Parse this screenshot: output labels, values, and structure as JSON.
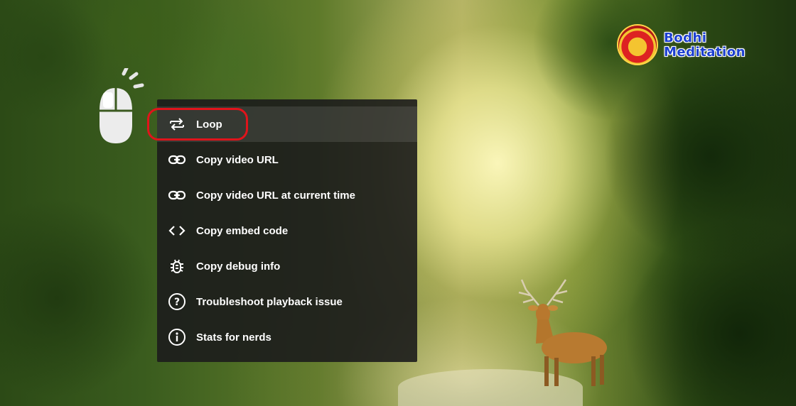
{
  "logo": {
    "line1": "Bodhi",
    "line2": "Meditation"
  },
  "menu": {
    "items": [
      {
        "label": "Loop",
        "icon": "loop-icon",
        "highlighted": true
      },
      {
        "label": "Copy video URL",
        "icon": "link-icon"
      },
      {
        "label": "Copy video URL at current time",
        "icon": "link-icon"
      },
      {
        "label": "Copy embed code",
        "icon": "code-icon"
      },
      {
        "label": "Copy debug info",
        "icon": "bug-icon"
      },
      {
        "label": "Troubleshoot playback issue",
        "icon": "question-circle-icon"
      },
      {
        "label": "Stats for nerds",
        "icon": "info-circle-icon"
      }
    ]
  },
  "colors": {
    "menu_bg": "#1c1c1c",
    "menu_text": "#ffffff",
    "highlight_ring": "#e0141b",
    "logo_text": "#1c3fd0"
  }
}
